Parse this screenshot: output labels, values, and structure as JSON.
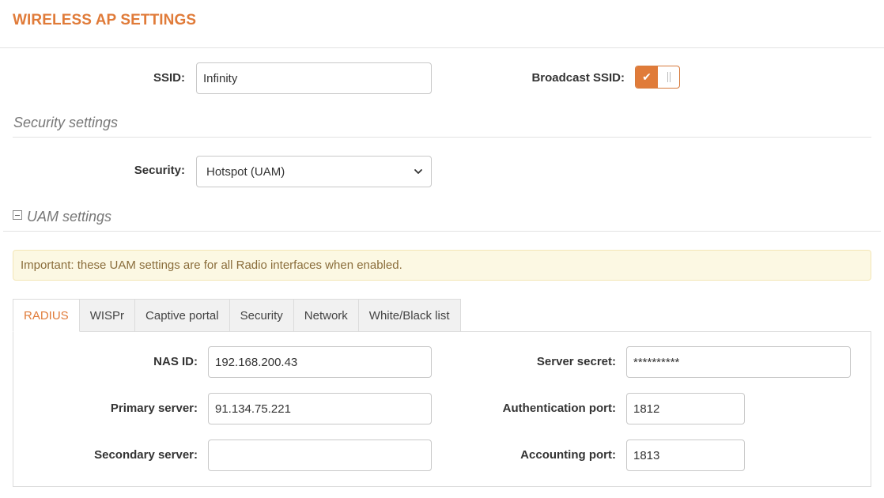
{
  "page": {
    "title": "WIRELESS AP SETTINGS"
  },
  "ssid": {
    "label": "SSID:",
    "value": "Infinity"
  },
  "broadcast_ssid": {
    "label": "Broadcast SSID:",
    "enabled": true,
    "check_glyph": "✔"
  },
  "security_section": {
    "title": "Security settings"
  },
  "security": {
    "label": "Security:",
    "selected": "Hotspot (UAM)"
  },
  "uam_section": {
    "title": "UAM settings",
    "collapse_icon": "minus-square-icon"
  },
  "alert": {
    "text": "Important: these UAM settings are for all Radio interfaces when enabled."
  },
  "tabs": [
    {
      "label": "RADIUS",
      "active": true
    },
    {
      "label": "WISPr"
    },
    {
      "label": "Captive portal"
    },
    {
      "label": "Security"
    },
    {
      "label": "Network"
    },
    {
      "label": "White/Black list"
    }
  ],
  "radius": {
    "nas_id": {
      "label": "NAS ID:",
      "value": "192.168.200.43"
    },
    "primary_server": {
      "label": "Primary server:",
      "value": "91.134.75.221"
    },
    "secondary_server": {
      "label": "Secondary server:",
      "value": ""
    },
    "server_secret": {
      "label": "Server secret:",
      "value": "**********"
    },
    "auth_port": {
      "label": "Authentication port:",
      "value": "1812"
    },
    "acct_port": {
      "label": "Accounting port:",
      "value": "1813"
    }
  },
  "colors": {
    "accent": "#e07b39",
    "alert_bg": "#fcf8e3",
    "alert_text": "#8a6d3b"
  }
}
